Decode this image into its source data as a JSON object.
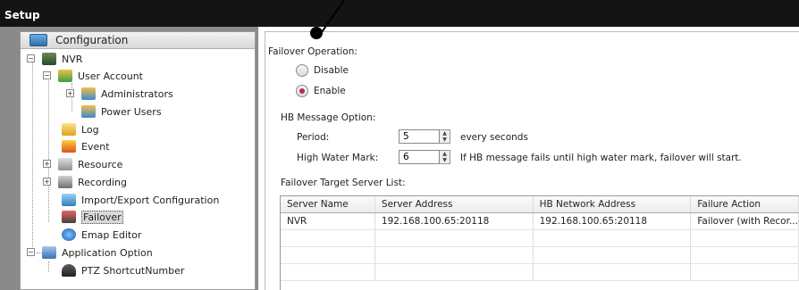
{
  "window": {
    "title": "Setup"
  },
  "sidebar": {
    "header": "Configuration",
    "tree": [
      {
        "label": "NVR"
      },
      {
        "label": "User Account"
      },
      {
        "label": "Administrators"
      },
      {
        "label": "Power Users"
      },
      {
        "label": "Log"
      },
      {
        "label": "Event"
      },
      {
        "label": "Resource"
      },
      {
        "label": "Recording"
      },
      {
        "label": "Import/Export Configuration"
      },
      {
        "label": "Failover"
      },
      {
        "label": "Emap Editor"
      },
      {
        "label": "Application Option"
      },
      {
        "label": "PTZ ShortcutNumber"
      }
    ],
    "selected": "Failover"
  },
  "failover": {
    "operation_title": "Failover Operation:",
    "options": [
      "Disable",
      "Enable"
    ],
    "selected_option": "Enable",
    "hb_title": "HB Message Option:",
    "period_label": "Period:",
    "period_value": "5",
    "period_suffix": "every seconds",
    "hwm_label": "High Water Mark:",
    "hwm_value": "6",
    "hwm_suffix": "If HB message fails until high water mark, failover will start.",
    "target_title": "Failover Target Server List:"
  },
  "table": {
    "columns": [
      "Server Name",
      "Server Address",
      "HB Network Address",
      "Failure Action"
    ],
    "rows": [
      [
        "NVR",
        "192.168.100.65:20118",
        "192.168.100.65:20118",
        "Failover (with Recor..."
      ]
    ]
  },
  "colors": {
    "titlebar": "#141414",
    "radio_selected": "#c0284a"
  }
}
